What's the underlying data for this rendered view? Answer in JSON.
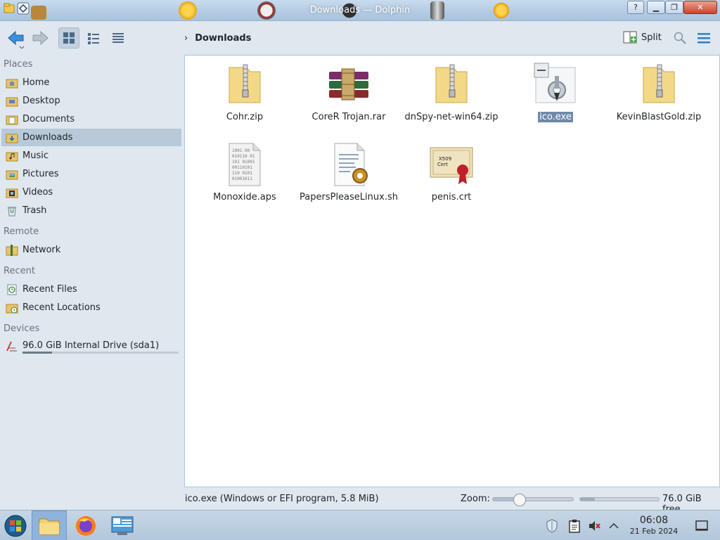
{
  "window": {
    "title": "Downloads — Dolphin"
  },
  "toolbar": {
    "breadcrumb": "Downloads",
    "split_label": "Split"
  },
  "sidebar": {
    "places_title": "Places",
    "places": [
      {
        "label": "Home",
        "icon": "home-folder-icon"
      },
      {
        "label": "Desktop",
        "icon": "desktop-folder-icon"
      },
      {
        "label": "Documents",
        "icon": "documents-folder-icon"
      },
      {
        "label": "Downloads",
        "icon": "downloads-folder-icon",
        "active": true
      },
      {
        "label": "Music",
        "icon": "music-folder-icon"
      },
      {
        "label": "Pictures",
        "icon": "pictures-folder-icon"
      },
      {
        "label": "Videos",
        "icon": "videos-folder-icon"
      },
      {
        "label": "Trash",
        "icon": "trash-icon"
      }
    ],
    "remote_title": "Remote",
    "remote": [
      {
        "label": "Network",
        "icon": "network-folder-icon"
      }
    ],
    "recent_title": "Recent",
    "recent": [
      {
        "label": "Recent Files",
        "icon": "recent-files-icon"
      },
      {
        "label": "Recent Locations",
        "icon": "recent-locations-icon"
      }
    ],
    "devices_title": "Devices",
    "devices": [
      {
        "label": "96.0 GiB Internal Drive (sda1)",
        "icon": "hard-drive-icon",
        "usage_fraction": 0.19
      }
    ]
  },
  "files": [
    {
      "name": "Cohr.zip",
      "type": "zip"
    },
    {
      "name": "CoreR Trojan.rar",
      "type": "rar"
    },
    {
      "name": "dnSpy-net-win64.zip",
      "type": "zip"
    },
    {
      "name": "ico.exe",
      "type": "exe",
      "selected": true
    },
    {
      "name": "KevinBlastGold.zip",
      "type": "zip"
    },
    {
      "name": "Monoxide.aps",
      "type": "binary"
    },
    {
      "name": "PapersPleaseLinux.sh",
      "type": "script"
    },
    {
      "name": "penis.crt",
      "type": "certificate"
    }
  ],
  "statusbar": {
    "selection_info": "ico.exe (Windows or EFI program, 5.8 MiB)",
    "zoom_label": "Zoom:",
    "zoom_fraction": 0.3,
    "free_space": "76.0 GiB free",
    "free_used_fraction": 0.19
  },
  "taskbar": {
    "time": "06:08",
    "date": "21 Feb 2024"
  },
  "colors": {
    "selection": "#6f8aa8",
    "sidebar_active": "#b8c9d9",
    "view_border": "#a7c6e2",
    "accent_blue": "#2a7fd4"
  }
}
